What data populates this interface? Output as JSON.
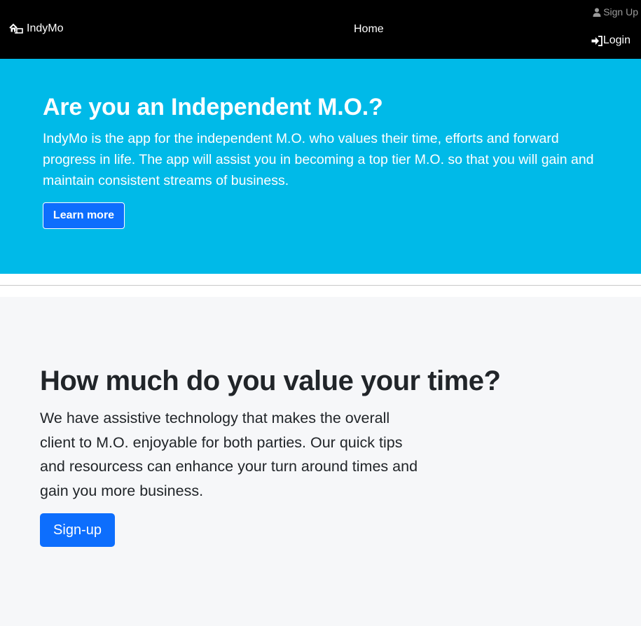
{
  "navbar": {
    "brand": {
      "label": "IndyMo",
      "icon": "house-swap-icon"
    },
    "home_label": "Home",
    "signup": {
      "label": "Sign Up",
      "icon": "person-icon"
    },
    "login": {
      "label": "Login",
      "icon": "sign-in-icon"
    }
  },
  "hero": {
    "title": "Are you an Independent M.O.?",
    "text": "IndyMo is the app for the independent M.O. who values their time, efforts and forward progress in life. The app will assist you in becoming a top tier M.O. so that you will gain and maintain consistent streams of business.",
    "button_label": "Learn more"
  },
  "section2": {
    "title": "How much do you value your time?",
    "text": "We have assistive technology that makes the overall client to M.O. enjoyable for both parties. Our quick tips and resourcess can enhance your turn around times and gain you more business.",
    "button_label": "Sign-up"
  },
  "colors": {
    "navbar_bg": "#000000",
    "hero_bg": "#00bae8",
    "section_bg": "#f6f7f9",
    "primary": "#0d6efd"
  }
}
